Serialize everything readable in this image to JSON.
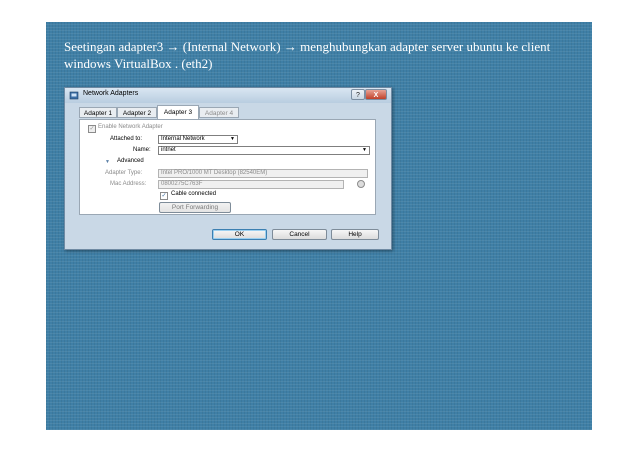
{
  "slide": {
    "title": "Seetingan adapter3 → (Internal Network) → menghubungkan adapter server ubuntu ke client windows VirtualBox . (eth2)"
  },
  "dialog": {
    "title": "Network Adapters",
    "help_glyph": "?",
    "close_glyph": "X",
    "tabs": [
      "Adapter 1",
      "Adapter 2",
      "Adapter 3",
      "Adapter 4"
    ],
    "active_tab": "Adapter 3",
    "enable_label": "Enable Network Adapter",
    "enable_checked": true,
    "attached_label": "Attached to:",
    "attached_value": "Internal Network",
    "name_label": "Name:",
    "name_value": "intnet",
    "advanced_label": "Advanced",
    "adapter_type_label": "Adapter Type:",
    "adapter_type_value": "Intel PRO/1000 MT Desktop (82540EM)",
    "mac_label": "Mac Address:",
    "mac_value": "0800275C763F",
    "cable_label": "Cable connected",
    "cable_checked": true,
    "port_forwarding_label": "Port Forwarding",
    "ok_label": "OK",
    "cancel_label": "Cancel",
    "help_label": "Help",
    "check_glyph": "✓",
    "dropdown_glyph": "▼",
    "expander_glyph": "▼"
  },
  "colors": {
    "slide_background": "#3f7fa6",
    "dialog_frame": "#c9d8e6",
    "close_button": "#c0412a"
  },
  "icons": [
    "virtualbox-icon",
    "help-icon",
    "close-icon",
    "chevron-down-icon",
    "refresh-mac-icon",
    "check-icon"
  ]
}
